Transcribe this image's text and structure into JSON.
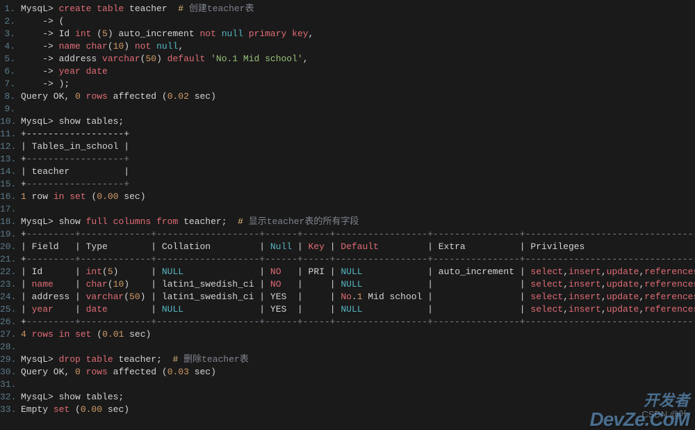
{
  "lines": [
    {
      "n": "1.",
      "tokens": [
        {
          "t": "MysqL> ",
          "c": "white"
        },
        {
          "t": "create",
          "c": "red"
        },
        {
          "t": " ",
          "c": "white"
        },
        {
          "t": "table",
          "c": "red"
        },
        {
          "t": " teacher  ",
          "c": "white"
        },
        {
          "t": "#",
          "c": "yellow"
        },
        {
          "t": " 创建teacher表",
          "c": "grey"
        }
      ]
    },
    {
      "n": "2.",
      "tokens": [
        {
          "t": "    -> (",
          "c": "white"
        }
      ]
    },
    {
      "n": "3.",
      "tokens": [
        {
          "t": "    -> Id ",
          "c": "white"
        },
        {
          "t": "int",
          "c": "red"
        },
        {
          "t": " (",
          "c": "white"
        },
        {
          "t": "5",
          "c": "orange"
        },
        {
          "t": ") auto_increment ",
          "c": "white"
        },
        {
          "t": "not",
          "c": "red"
        },
        {
          "t": " ",
          "c": "white"
        },
        {
          "t": "null",
          "c": "cyan"
        },
        {
          "t": " ",
          "c": "white"
        },
        {
          "t": "primary",
          "c": "red"
        },
        {
          "t": " ",
          "c": "white"
        },
        {
          "t": "key",
          "c": "red"
        },
        {
          "t": ",",
          "c": "white"
        }
      ]
    },
    {
      "n": "4.",
      "tokens": [
        {
          "t": "    -> ",
          "c": "white"
        },
        {
          "t": "name",
          "c": "red"
        },
        {
          "t": " ",
          "c": "white"
        },
        {
          "t": "char",
          "c": "red"
        },
        {
          "t": "(",
          "c": "white"
        },
        {
          "t": "10",
          "c": "orange"
        },
        {
          "t": ") ",
          "c": "white"
        },
        {
          "t": "not",
          "c": "red"
        },
        {
          "t": " ",
          "c": "white"
        },
        {
          "t": "null",
          "c": "cyan"
        },
        {
          "t": ",",
          "c": "white"
        }
      ]
    },
    {
      "n": "5.",
      "tokens": [
        {
          "t": "    -> address ",
          "c": "white"
        },
        {
          "t": "varchar",
          "c": "red"
        },
        {
          "t": "(",
          "c": "white"
        },
        {
          "t": "50",
          "c": "orange"
        },
        {
          "t": ") ",
          "c": "white"
        },
        {
          "t": "default",
          "c": "red"
        },
        {
          "t": " ",
          "c": "white"
        },
        {
          "t": "'No.1 Mid school'",
          "c": "green"
        },
        {
          "t": ",",
          "c": "white"
        }
      ]
    },
    {
      "n": "6.",
      "tokens": [
        {
          "t": "    -> ",
          "c": "white"
        },
        {
          "t": "year",
          "c": "red"
        },
        {
          "t": " ",
          "c": "white"
        },
        {
          "t": "date",
          "c": "red"
        }
      ]
    },
    {
      "n": "7.",
      "tokens": [
        {
          "t": "    -> );",
          "c": "white"
        }
      ]
    },
    {
      "n": "8.",
      "tokens": [
        {
          "t": "Query OK, ",
          "c": "white"
        },
        {
          "t": "0",
          "c": "orange"
        },
        {
          "t": " ",
          "c": "white"
        },
        {
          "t": "rows",
          "c": "red"
        },
        {
          "t": " affected (",
          "c": "white"
        },
        {
          "t": "0.02",
          "c": "orange"
        },
        {
          "t": " sec)",
          "c": "white"
        }
      ]
    },
    {
      "n": "9.",
      "tokens": [
        {
          "t": " ",
          "c": "white"
        }
      ]
    },
    {
      "n": "10.",
      "tokens": [
        {
          "t": "MysqL> show tables;",
          "c": "white"
        }
      ]
    },
    {
      "n": "11.",
      "tokens": [
        {
          "t": "+------------------+",
          "c": "white"
        }
      ]
    },
    {
      "n": "12.",
      "tokens": [
        {
          "t": "| Tables_in_school |",
          "c": "white"
        }
      ]
    },
    {
      "n": "13.",
      "tokens": [
        {
          "t": "+",
          "c": "white"
        },
        {
          "t": "------------------+",
          "c": "grey"
        }
      ]
    },
    {
      "n": "14.",
      "tokens": [
        {
          "t": "| teacher          |",
          "c": "white"
        }
      ]
    },
    {
      "n": "15.",
      "tokens": [
        {
          "t": "+",
          "c": "white"
        },
        {
          "t": "------------------+",
          "c": "grey"
        }
      ]
    },
    {
      "n": "16.",
      "tokens": [
        {
          "t": "1",
          "c": "orange"
        },
        {
          "t": " row ",
          "c": "white"
        },
        {
          "t": "in",
          "c": "red"
        },
        {
          "t": " ",
          "c": "white"
        },
        {
          "t": "set",
          "c": "red"
        },
        {
          "t": " (",
          "c": "white"
        },
        {
          "t": "0.00",
          "c": "orange"
        },
        {
          "t": " sec)",
          "c": "white"
        }
      ]
    },
    {
      "n": "17.",
      "tokens": [
        {
          "t": " ",
          "c": "white"
        }
      ]
    },
    {
      "n": "18.",
      "tokens": [
        {
          "t": "MysqL> show ",
          "c": "white"
        },
        {
          "t": "full",
          "c": "red"
        },
        {
          "t": " ",
          "c": "white"
        },
        {
          "t": "columns",
          "c": "red"
        },
        {
          "t": " ",
          "c": "white"
        },
        {
          "t": "from",
          "c": "red"
        },
        {
          "t": " teacher;  ",
          "c": "white"
        },
        {
          "t": "#",
          "c": "yellow"
        },
        {
          "t": " 显示teacher表的所有字段",
          "c": "grey"
        }
      ]
    },
    {
      "n": "19.",
      "tokens": [
        {
          "t": "+",
          "c": "white"
        },
        {
          "t": "---------+-------------+-------------------+------+-----+-----------------+----------------+---------------------------------+---------+",
          "c": "grey"
        }
      ]
    },
    {
      "n": "20.",
      "tokens": [
        {
          "t": "| Field   | Type        | Collation         | ",
          "c": "white"
        },
        {
          "t": "Null",
          "c": "cyan"
        },
        {
          "t": " | ",
          "c": "white"
        },
        {
          "t": "Key",
          "c": "red"
        },
        {
          "t": " | ",
          "c": "white"
        },
        {
          "t": "Default",
          "c": "red"
        },
        {
          "t": "         | Extra          | Privileges                      | Comment |",
          "c": "white"
        }
      ]
    },
    {
      "n": "21.",
      "tokens": [
        {
          "t": "+",
          "c": "white"
        },
        {
          "t": "---------+-------------+-------------------+------+-----+-----------------+----------------+---------------------------------+---------+",
          "c": "grey"
        }
      ]
    },
    {
      "n": "22.",
      "tokens": [
        {
          "t": "| Id      | ",
          "c": "white"
        },
        {
          "t": "int",
          "c": "red"
        },
        {
          "t": "(",
          "c": "white"
        },
        {
          "t": "5",
          "c": "orange"
        },
        {
          "t": ")      | ",
          "c": "white"
        },
        {
          "t": "NULL",
          "c": "cyan"
        },
        {
          "t": "              | ",
          "c": "white"
        },
        {
          "t": "NO",
          "c": "red"
        },
        {
          "t": "   | PRI | ",
          "c": "white"
        },
        {
          "t": "NULL",
          "c": "cyan"
        },
        {
          "t": "            | auto_increment | ",
          "c": "white"
        },
        {
          "t": "select",
          "c": "red"
        },
        {
          "t": ",",
          "c": "white"
        },
        {
          "t": "insert",
          "c": "red"
        },
        {
          "t": ",",
          "c": "white"
        },
        {
          "t": "update",
          "c": "red"
        },
        {
          "t": ",",
          "c": "white"
        },
        {
          "t": "references",
          "c": "red"
        },
        {
          "t": " |         |",
          "c": "white"
        }
      ]
    },
    {
      "n": "23.",
      "tokens": [
        {
          "t": "| ",
          "c": "white"
        },
        {
          "t": "name",
          "c": "red"
        },
        {
          "t": "    | ",
          "c": "white"
        },
        {
          "t": "char",
          "c": "red"
        },
        {
          "t": "(",
          "c": "white"
        },
        {
          "t": "10",
          "c": "orange"
        },
        {
          "t": ")    | latin1_swedish_ci | ",
          "c": "white"
        },
        {
          "t": "NO",
          "c": "red"
        },
        {
          "t": "   |     | ",
          "c": "white"
        },
        {
          "t": "NULL",
          "c": "cyan"
        },
        {
          "t": "            |                | ",
          "c": "white"
        },
        {
          "t": "select",
          "c": "red"
        },
        {
          "t": ",",
          "c": "white"
        },
        {
          "t": "insert",
          "c": "red"
        },
        {
          "t": ",",
          "c": "white"
        },
        {
          "t": "update",
          "c": "red"
        },
        {
          "t": ",",
          "c": "white"
        },
        {
          "t": "references",
          "c": "red"
        },
        {
          "t": " |         |",
          "c": "white"
        }
      ]
    },
    {
      "n": "24.",
      "tokens": [
        {
          "t": "| address | ",
          "c": "white"
        },
        {
          "t": "varchar",
          "c": "red"
        },
        {
          "t": "(",
          "c": "white"
        },
        {
          "t": "50",
          "c": "orange"
        },
        {
          "t": ") | latin1_swedish_ci | YES  |     | ",
          "c": "white"
        },
        {
          "t": "No",
          "c": "red"
        },
        {
          "t": ".",
          "c": "white"
        },
        {
          "t": "1",
          "c": "orange"
        },
        {
          "t": " Mid school |                | ",
          "c": "white"
        },
        {
          "t": "select",
          "c": "red"
        },
        {
          "t": ",",
          "c": "white"
        },
        {
          "t": "insert",
          "c": "red"
        },
        {
          "t": ",",
          "c": "white"
        },
        {
          "t": "update",
          "c": "red"
        },
        {
          "t": ",",
          "c": "white"
        },
        {
          "t": "references",
          "c": "red"
        },
        {
          "t": " |         |",
          "c": "white"
        }
      ]
    },
    {
      "n": "25.",
      "tokens": [
        {
          "t": "| ",
          "c": "white"
        },
        {
          "t": "year",
          "c": "red"
        },
        {
          "t": "    | ",
          "c": "white"
        },
        {
          "t": "date",
          "c": "red"
        },
        {
          "t": "        | ",
          "c": "white"
        },
        {
          "t": "NULL",
          "c": "cyan"
        },
        {
          "t": "              | YES  |     | ",
          "c": "white"
        },
        {
          "t": "NULL",
          "c": "cyan"
        },
        {
          "t": "            |                | ",
          "c": "white"
        },
        {
          "t": "select",
          "c": "red"
        },
        {
          "t": ",",
          "c": "white"
        },
        {
          "t": "insert",
          "c": "red"
        },
        {
          "t": ",",
          "c": "white"
        },
        {
          "t": "update",
          "c": "red"
        },
        {
          "t": ",",
          "c": "white"
        },
        {
          "t": "references",
          "c": "red"
        },
        {
          "t": " |         |",
          "c": "white"
        }
      ]
    },
    {
      "n": "26.",
      "tokens": [
        {
          "t": "+",
          "c": "white"
        },
        {
          "t": "---------+-------------+-------------------+------+-----+-----------------+----------------+---------------------------------+---------+",
          "c": "grey"
        }
      ]
    },
    {
      "n": "27.",
      "tokens": [
        {
          "t": "4",
          "c": "orange"
        },
        {
          "t": " ",
          "c": "white"
        },
        {
          "t": "rows",
          "c": "red"
        },
        {
          "t": " ",
          "c": "white"
        },
        {
          "t": "in",
          "c": "red"
        },
        {
          "t": " ",
          "c": "white"
        },
        {
          "t": "set",
          "c": "red"
        },
        {
          "t": " (",
          "c": "white"
        },
        {
          "t": "0.01",
          "c": "orange"
        },
        {
          "t": " sec)",
          "c": "white"
        }
      ]
    },
    {
      "n": "28.",
      "tokens": [
        {
          "t": " ",
          "c": "white"
        }
      ]
    },
    {
      "n": "29.",
      "tokens": [
        {
          "t": "MysqL> ",
          "c": "white"
        },
        {
          "t": "drop",
          "c": "red"
        },
        {
          "t": " ",
          "c": "white"
        },
        {
          "t": "table",
          "c": "red"
        },
        {
          "t": " teacher;  ",
          "c": "white"
        },
        {
          "t": "#",
          "c": "yellow"
        },
        {
          "t": " 删除teacher表",
          "c": "grey"
        }
      ]
    },
    {
      "n": "30.",
      "tokens": [
        {
          "t": "Query OK, ",
          "c": "white"
        },
        {
          "t": "0",
          "c": "orange"
        },
        {
          "t": " ",
          "c": "white"
        },
        {
          "t": "rows",
          "c": "red"
        },
        {
          "t": " affected (",
          "c": "white"
        },
        {
          "t": "0.03",
          "c": "orange"
        },
        {
          "t": " sec)",
          "c": "white"
        }
      ]
    },
    {
      "n": "31.",
      "tokens": [
        {
          "t": " ",
          "c": "white"
        }
      ]
    },
    {
      "n": "32.",
      "tokens": [
        {
          "t": "MysqL> show tables;",
          "c": "white"
        }
      ]
    },
    {
      "n": "33.",
      "tokens": [
        {
          "t": "Empty ",
          "c": "white"
        },
        {
          "t": "set",
          "c": "red"
        },
        {
          "t": " (",
          "c": "white"
        },
        {
          "t": "0.00",
          "c": "orange"
        },
        {
          "t": " sec)",
          "c": "white"
        }
      ]
    }
  ],
  "watermark_csdn": "CSDN @叶",
  "watermark_cn": "开发者",
  "watermark_devze": "DevZe.CoM"
}
